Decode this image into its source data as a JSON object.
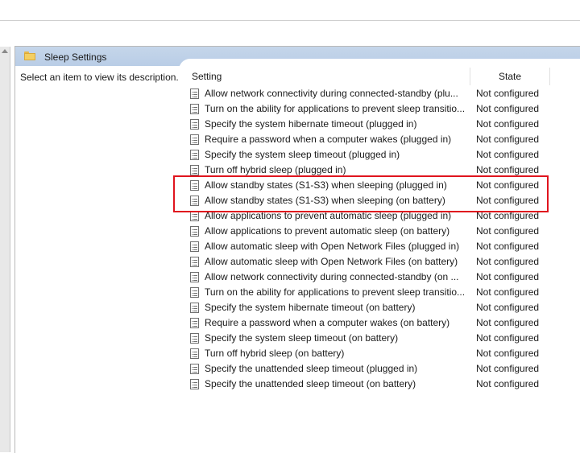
{
  "window": {
    "folder_title": "Sleep Settings",
    "folder_icon": "folder-icon",
    "description_prompt": "Select an item to view its description."
  },
  "columns": {
    "setting": "Setting",
    "state": "State"
  },
  "policy_icon": "policy-setting-icon",
  "highlight_color": "#e0141e",
  "rows": [
    {
      "name": "Allow network connectivity during connected-standby (plu...",
      "state": "Not configured"
    },
    {
      "name": "Turn on the ability for applications to prevent sleep transitio...",
      "state": "Not configured"
    },
    {
      "name": "Specify the system hibernate timeout (plugged in)",
      "state": "Not configured"
    },
    {
      "name": "Require a password when a computer wakes (plugged in)",
      "state": "Not configured"
    },
    {
      "name": "Specify the system sleep timeout (plugged in)",
      "state": "Not configured"
    },
    {
      "name": "Turn off hybrid sleep (plugged in)",
      "state": "Not configured"
    },
    {
      "name": "Allow standby states (S1-S3) when sleeping (plugged in)",
      "state": "Not configured"
    },
    {
      "name": "Allow standby states (S1-S3) when sleeping (on battery)",
      "state": "Not configured"
    },
    {
      "name": "Allow applications to prevent automatic sleep (plugged in)",
      "state": "Not configured"
    },
    {
      "name": "Allow applications to prevent automatic sleep (on battery)",
      "state": "Not configured"
    },
    {
      "name": "Allow automatic sleep with Open Network Files (plugged in)",
      "state": "Not configured"
    },
    {
      "name": "Allow automatic sleep with Open Network Files (on battery)",
      "state": "Not configured"
    },
    {
      "name": "Allow network connectivity during connected-standby (on ...",
      "state": "Not configured"
    },
    {
      "name": "Turn on the ability for applications to prevent sleep transitio...",
      "state": "Not configured"
    },
    {
      "name": "Specify the system hibernate timeout (on battery)",
      "state": "Not configured"
    },
    {
      "name": "Require a password when a computer wakes (on battery)",
      "state": "Not configured"
    },
    {
      "name": "Specify the system sleep timeout (on battery)",
      "state": "Not configured"
    },
    {
      "name": "Turn off hybrid sleep (on battery)",
      "state": "Not configured"
    },
    {
      "name": "Specify the unattended sleep timeout (plugged in)",
      "state": "Not configured"
    },
    {
      "name": "Specify the unattended sleep timeout (on battery)",
      "state": "Not configured"
    }
  ]
}
